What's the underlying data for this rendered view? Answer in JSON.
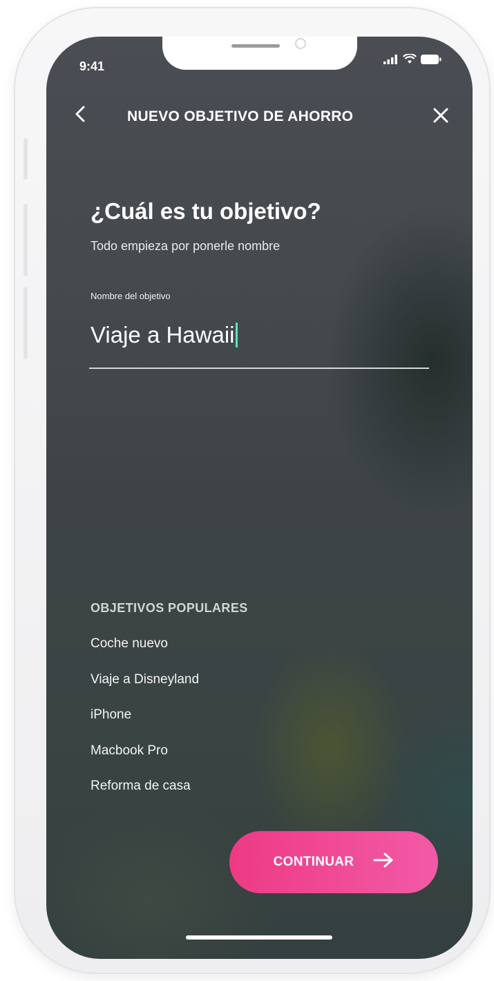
{
  "status_bar": {
    "time": "9:41"
  },
  "header": {
    "title": "NUEVO OBJETIVO DE AHORRO"
  },
  "main": {
    "heading": "¿Cuál es tu objetivo?",
    "subheading": "Todo empieza por ponerle nombre",
    "field_label": "Nombre del objetivo",
    "field_value": "Viaje a Hawaii"
  },
  "popular": {
    "title": "OBJETIVOS POPULARES",
    "items": [
      "Coche nuevo",
      "Viaje a Disneyland",
      "iPhone",
      "Macbook Pro",
      "Reforma de casa"
    ]
  },
  "actions": {
    "continue_label": "CONTINUAR"
  },
  "icons": {
    "back": "chevron-left-icon",
    "close": "close-icon",
    "continue": "arrow-right-icon",
    "signal": "signal-icon",
    "wifi": "wifi-icon",
    "battery": "battery-icon"
  },
  "colors": {
    "accent": "#EE3A85",
    "accent_end": "#F25AA6",
    "caret": "#5EE3C4",
    "background": "#45494D"
  }
}
